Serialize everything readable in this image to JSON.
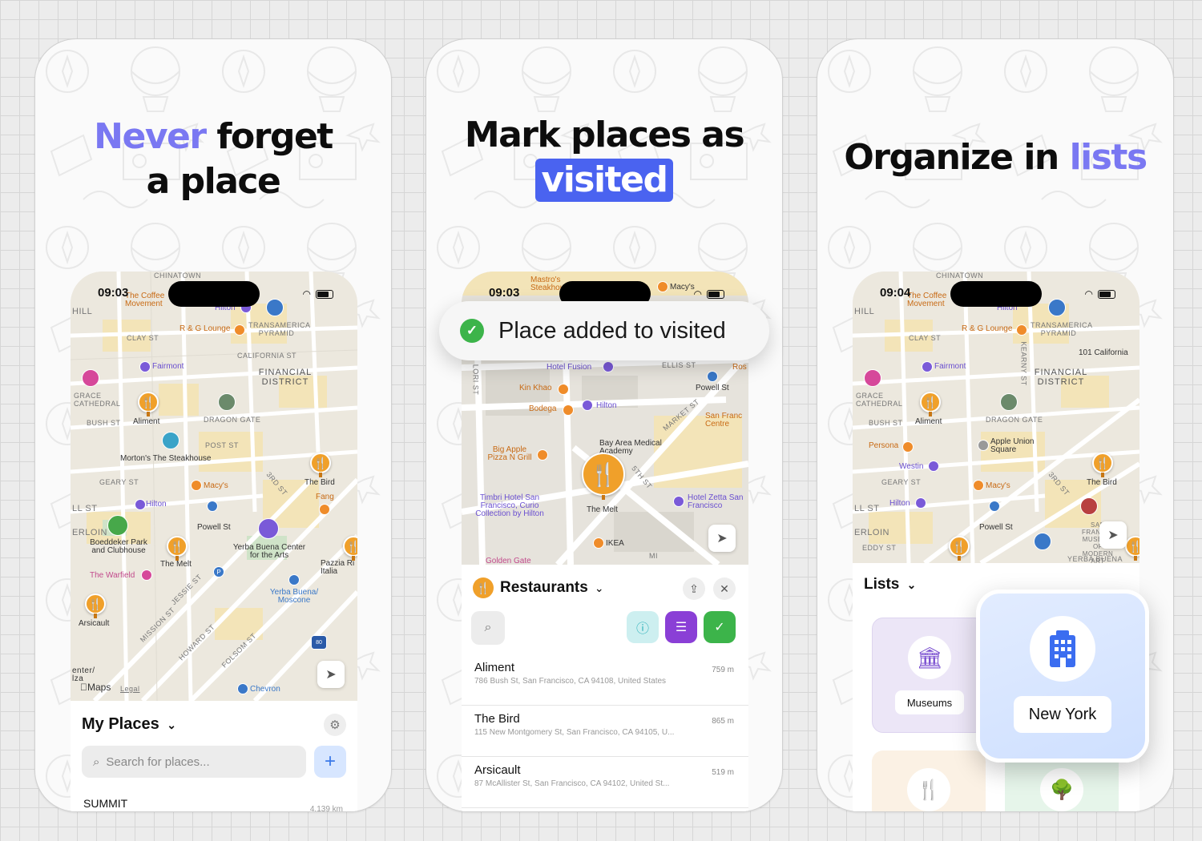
{
  "screens": [
    {
      "headline_line1_highlight": "Never",
      "headline_line1_rest": "forget",
      "headline_line2": "a place",
      "status_time": "09:03",
      "map_labels": {
        "chinatown": "CHINATOWN",
        "hill": "HILL",
        "coffee": "The Coffee Movement",
        "hilton_top": "Hilton",
        "transamerica": "TRANSAMERICA PYRAMID",
        "rg_lounge": "R & G Lounge",
        "clay_st": "CLAY ST",
        "fairmont": "Fairmont",
        "california_st": "CALIFORNIA ST",
        "financial": "FINANCIAL DISTRICT",
        "grace": "GRACE CATHEDRAL",
        "aliment": "Aliment",
        "dragon_gate": "DRAGON GATE",
        "bush_st": "BUSH ST",
        "post_st": "POST ST",
        "mortons": "Morton's The Steakhouse",
        "the_bird": "The Bird",
        "macys": "Macy's",
        "geary_st": "GEARY ST",
        "third_st": "3RD ST",
        "hilton_mid": "Hilton",
        "fang": "Fang",
        "powell": "Powell St",
        "boeddeker": "Boeddeker Park and Clubhouse",
        "yerba": "Yerba Buena Center for the Arts",
        "pazzia": "Pazzia Ri Italia",
        "the_melt": "The Melt",
        "the_warfield": "The Warfield",
        "yerba_moscone": "Yerba Buena/ Moscone",
        "arsicault": "Arsicault",
        "mission_st": "MISSION ST",
        "howard_st": "HOWARD ST",
        "folsom_st": "FOLSOM ST",
        "chevron": "Chevron",
        "maps": "Maps",
        "legal": "Legal",
        "erloin": "ERLOIN",
        "ll_st": "LL ST",
        "jessie_st": "JESSIE ST",
        "enter": "enter/ lza"
      },
      "sheet_title": "My Places",
      "search_placeholder": "Search for places...",
      "first_item_name": "SUMMIT",
      "first_item_dist": "4,139 km"
    },
    {
      "headline_line1": "Mark places as",
      "headline_line2_highlight": "visited",
      "status_time": "09:03",
      "toast_text": "Place added to visited",
      "map_labels": {
        "mastro": "Mastro's Steakhouse",
        "macys": "Macy's",
        "hotel_fusion": "Hotel Fusion",
        "ellis_st": "ELLIS ST",
        "ros": "Ros",
        "lori_st": "LORI ST",
        "kin_khao": "Kin Khao",
        "powell": "Powell St",
        "hilton": "Hilton",
        "bodega": "Bodega",
        "market_st": "MARKET ST",
        "sf_centre": "San Franc Centre",
        "bay_area": "Bay Area Medical Academy",
        "big_apple": "Big Apple Pizza N Grill",
        "fifth_st": "5TH ST",
        "timbri": "Timbri Hotel San Francisco, Curio Collection by Hilton",
        "the_melt": "The Melt",
        "zetta": "Hotel Zetta San Francisco",
        "ikea": "IKEA",
        "golden_gate": "Golden Gate",
        "mi": "MI"
      },
      "sheet_title": "Restaurants",
      "rows": [
        {
          "name": "Aliment",
          "address": "786 Bush St, San Francisco, CA  94108, United States",
          "dist": "759 m"
        },
        {
          "name": "The Bird",
          "address": "115 New Montgomery St, San Francisco, CA  94105, U...",
          "dist": "865 m"
        },
        {
          "name": "Arsicault",
          "address": "87 McAllister St, San Francisco, CA  94102, United St...",
          "dist": "519 m"
        }
      ]
    },
    {
      "headline_main": "Organize in",
      "headline_highlight": "lists",
      "status_time": "09:04",
      "map_labels": {
        "chinatown": "CHINATOWN",
        "hill": "HILL",
        "coffee": "The Coffee Movement",
        "hilton_top": "Hilton",
        "transamerica": "TRANSAMERICA PYRAMID",
        "rg_lounge": "R & G Lounge",
        "clay_st": "CLAY ST",
        "kearny": "KEARNY ST",
        "california101": "101 California",
        "fairmont": "Fairmont",
        "financial": "FINANCIAL DISTRICT",
        "grace": "GRACE CATHEDRAL",
        "aliment": "Aliment",
        "dragon_gate": "DRAGON GATE",
        "bush_st": "BUSH ST",
        "persona": "Persona",
        "apple_union": "Apple Union Square",
        "westin": "Westin",
        "geary_st": "GEARY ST",
        "macys": "Macy's",
        "third_st": "3RD ST",
        "the_bird": "The Bird",
        "hilton_mid": "Hilton",
        "powell": "Powell St",
        "sfmoma": "SAN FRANCISCO MUSEUM OF MODERN ART",
        "yerba_buena": "YERBA BUENA",
        "erloin": "ERLOIN",
        "ll_st": "LL ST",
        "eddy_st": "EDDY ST"
      },
      "lists_title": "Lists",
      "tiles": [
        {
          "label": "Museums",
          "icon": "museum-icon"
        },
        {
          "label": "New York",
          "icon": "building-icon"
        }
      ]
    }
  ],
  "colors": {
    "accent_purple": "#7a78f2",
    "pill_blue": "#4a63f0",
    "pin_orange": "#f0a02a",
    "visited_green": "#3cb44a",
    "list_purple": "#8a3fd6",
    "info_teal": "#cdeff0"
  }
}
